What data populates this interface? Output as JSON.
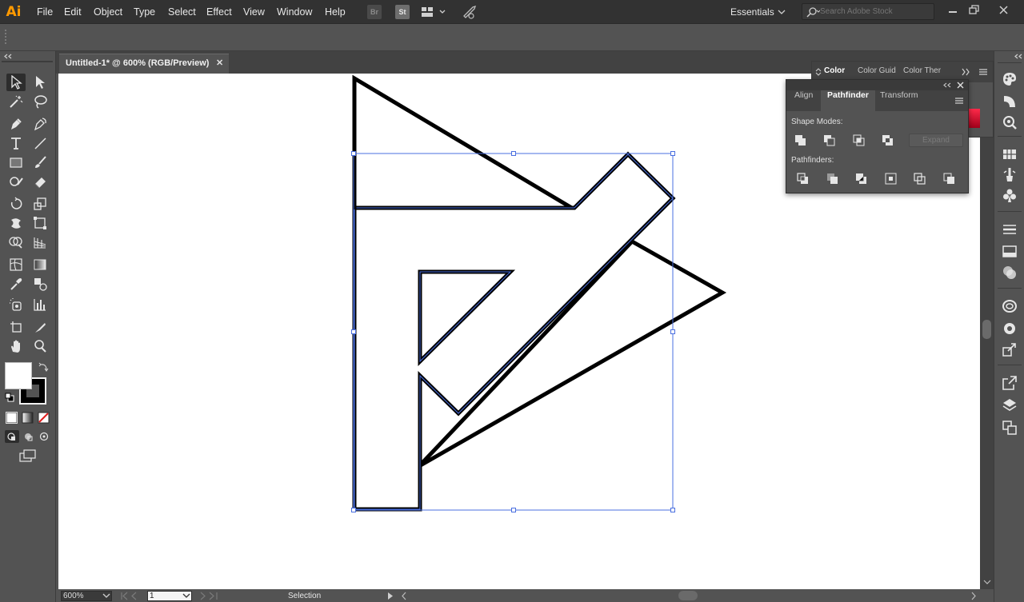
{
  "app": {
    "logo": "Ai"
  },
  "menubar": {
    "items": [
      "File",
      "Edit",
      "Object",
      "Type",
      "Select",
      "Effect",
      "View",
      "Window",
      "Help"
    ],
    "bridge_label": "Br",
    "stock_label": "St",
    "workspace": "Essentials",
    "search_placeholder": "Search Adobe Stock"
  },
  "document": {
    "tab_title": "Untitled-1* @ 600% (RGB/Preview)",
    "close_symbol": "✕"
  },
  "panels": {
    "color_tabs": [
      "Color",
      "Color Guid",
      "Color Ther"
    ],
    "pathfinder_tabs": [
      "Align",
      "Pathfinder",
      "Transform"
    ],
    "active_tab": "Pathfinder",
    "shape_modes_label": "Shape Modes:",
    "pathfinders_label": "Pathfinders:",
    "expand_label": "Expand"
  },
  "status": {
    "zoom": "600%",
    "artboard": "1",
    "tool_label": "Selection"
  },
  "colors": {
    "accent": "#ff9a00",
    "selection": "#4a6fe0",
    "ui_bg": "#535353",
    "menu_bg": "#323232"
  }
}
